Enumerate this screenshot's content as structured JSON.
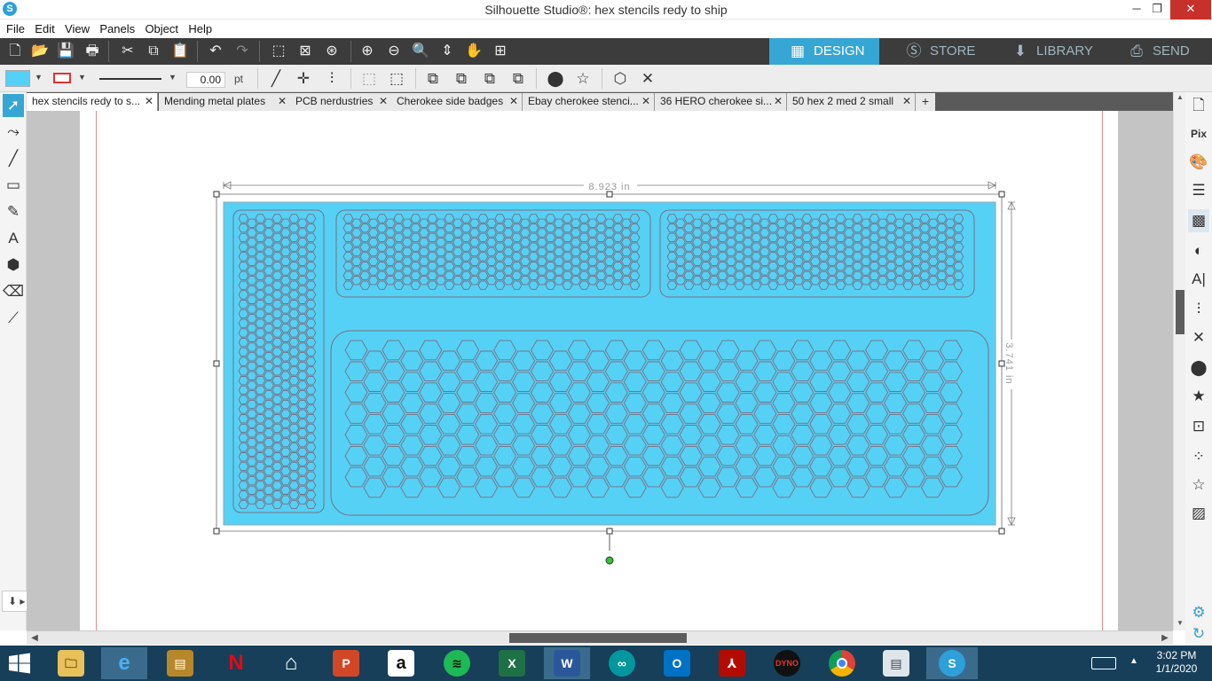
{
  "window": {
    "title": "Silhouette Studio®: hex stencils redy to ship",
    "min": "─",
    "max": "❐",
    "close": "✕"
  },
  "menu": [
    "File",
    "Edit",
    "View",
    "Panels",
    "Object",
    "Help"
  ],
  "nav": {
    "design": "DESIGN",
    "store": "STORE",
    "library": "LIBRARY",
    "send": "SEND"
  },
  "toolbar_secondary": {
    "line_width": "0.00",
    "unit": "pt"
  },
  "doc_tabs": [
    "hex stencils redy to s...",
    "Mending metal plates",
    "PCB nerdustries",
    "Cherokee side badges",
    "Ebay cherokee stenci...",
    "36 HERO cherokee si...",
    "50 hex 2 med 2 small"
  ],
  "dimensions": {
    "width": "8.923 in",
    "height": "3.741 in"
  },
  "design": {
    "fill_color": "#55d1f5",
    "stroke_color": "#7a6f82"
  },
  "taskbar": {
    "apps": [
      "file-explorer",
      "internet-explorer",
      "notes",
      "netflix",
      "home",
      "powerpoint",
      "amazon",
      "spotify",
      "excel",
      "word",
      "arduino",
      "outlook",
      "acrobat",
      "dyno",
      "chrome",
      "document-viewer",
      "silhouette-studio"
    ],
    "time": "3:02 PM",
    "date": "1/1/2020"
  },
  "colors": {
    "accent": "#36a6d4",
    "toolbar_dark": "#3c3c3c",
    "taskbar": "#173f59"
  }
}
